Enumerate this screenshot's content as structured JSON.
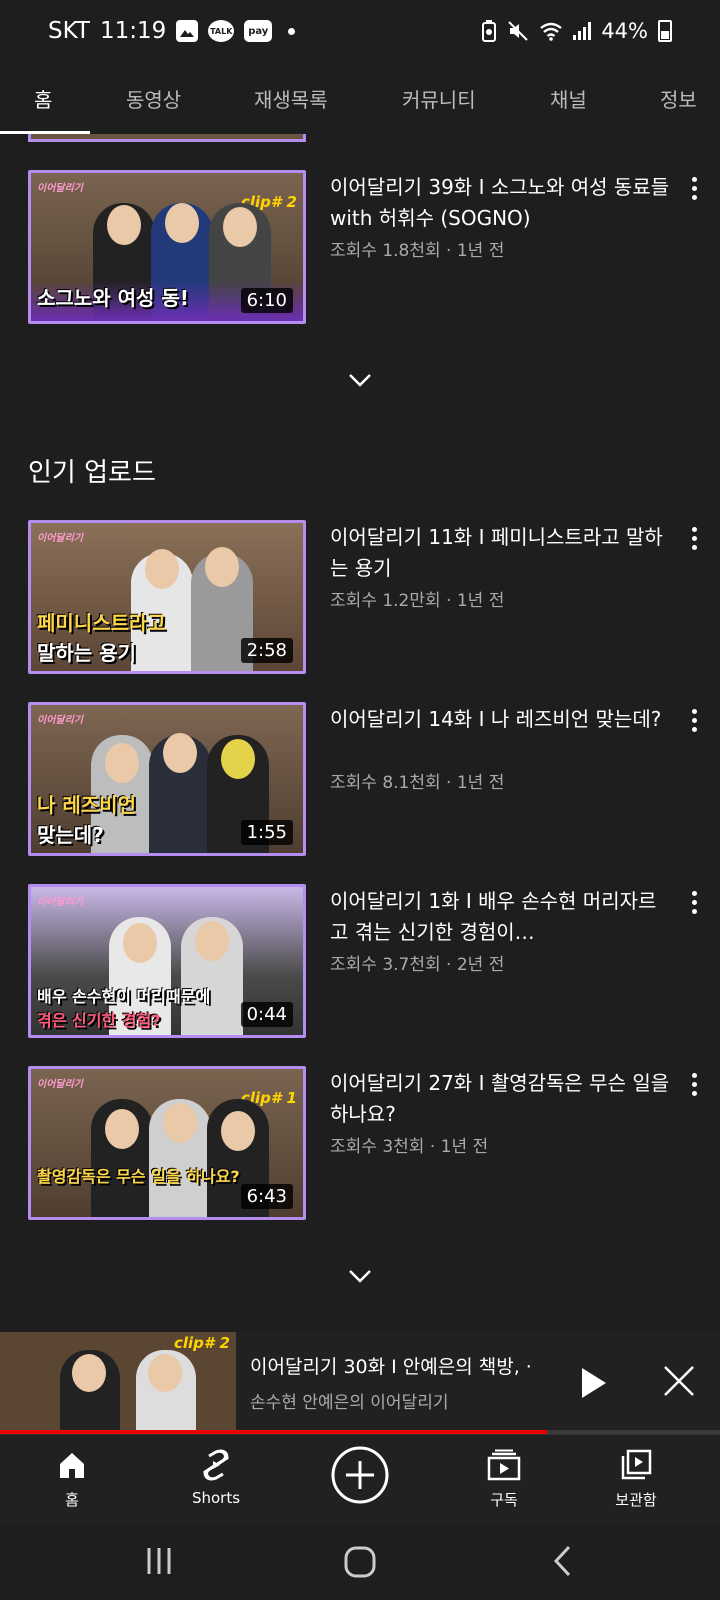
{
  "status_bar": {
    "carrier": "SKT",
    "time": "11:19",
    "talk_icon_text": "TALK",
    "pay_icon_text": "pay",
    "battery": "44%"
  },
  "tabs": [
    "홈",
    "동영상",
    "재생목록",
    "커뮤니티",
    "채널",
    "정보"
  ],
  "active_tab_index": 0,
  "videos_top": [
    {
      "title": "이어달리기 39화 I 소그노와 여성 동료들 with 허휘수 (SOGNO)",
      "meta": "조회수 1.8천회 · 1년 전",
      "duration": "6:10",
      "thumb_caption": "소그노와 여성 동!",
      "thumb_tag": "clip# 2"
    }
  ],
  "section_title": "인기 업로드",
  "videos_popular": [
    {
      "title": "이어달리기 11화 I 페미니스트라고 말하는 용기",
      "meta": "조회수 1.2만회 · 1년 전",
      "duration": "2:58",
      "thumb_caption": "페미니스트라고",
      "thumb_caption2": "말하는 용기"
    },
    {
      "title": "이어달리기 14화 I 나 레즈비언 맞는데?",
      "meta": "조회수 8.1천회 · 1년 전",
      "duration": "1:55",
      "thumb_caption": "나 레즈비언",
      "thumb_caption2": "맞는데?"
    },
    {
      "title": "이어달리기 1화  I  배우 손수현 머리자르고 겪는 신기한 경험이…",
      "meta": "조회수 3.7천회 · 2년 전",
      "duration": "0:44",
      "thumb_caption": "배우 손수현이 머리때문에",
      "thumb_caption2": "겪은 신기한 경험?"
    },
    {
      "title": "이어달리기 27화 I 촬영감독은 무슨 일을 하나요?",
      "meta": "조회수 3천회 · 1년 전",
      "duration": "6:43",
      "thumb_caption": "촬영감독은 무슨 일을 하나요?",
      "thumb_tag": "clip# 1"
    }
  ],
  "mini_player": {
    "title": "이어달리기 30화 I 안예은의 책방, ·",
    "channel": "손수현 안예은의 이어달리기",
    "thumb_tag": "clip# 2",
    "progress": 0.76
  },
  "bottom_nav": [
    {
      "label": "홈",
      "icon": "home-icon"
    },
    {
      "label": "Shorts",
      "icon": "shorts-icon"
    },
    {
      "label": "",
      "icon": "create-icon"
    },
    {
      "label": "구독",
      "icon": "subscriptions-icon"
    },
    {
      "label": "보관함",
      "icon": "library-icon"
    }
  ]
}
